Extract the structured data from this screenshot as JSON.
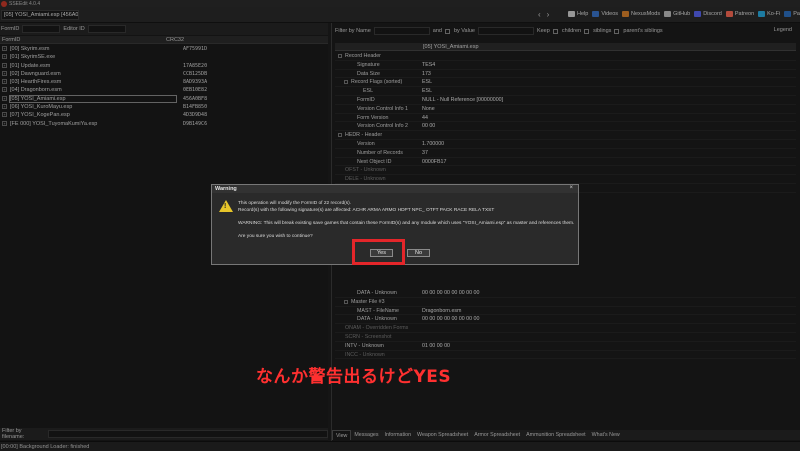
{
  "app": {
    "title": "SSEEdit 4.0.4"
  },
  "toolbar": {
    "path_field": "[05] YOSI_Amiami.esp [456A0BF8]",
    "back_arrow": "‹",
    "forward_arrow": "›",
    "links": [
      {
        "label": "Help",
        "icon": "home-icon",
        "color": "#d1d1d1"
      },
      {
        "label": "Videos",
        "icon": "video-icon",
        "color": "#3a73c9"
      },
      {
        "label": "NexusMods",
        "icon": "nexus-icon",
        "color": "#d9812b"
      },
      {
        "label": "GitHub",
        "icon": "github-icon",
        "color": "#bdbdbd"
      },
      {
        "label": "Discord",
        "icon": "discord-icon",
        "color": "#5865f2"
      },
      {
        "label": "Patreon",
        "icon": "patreon-icon",
        "color": "#f96854"
      },
      {
        "label": "Ko-Fi",
        "icon": "kofi-icon",
        "color": "#29abe0"
      },
      {
        "label": "PayPal",
        "icon": "paypal-icon",
        "color": "#2d6fc0"
      }
    ]
  },
  "left": {
    "filter_formid_label": "FormID",
    "filter_editorid_label": "Editor ID",
    "col_formid": "FormID",
    "col_crc": "CRC32",
    "plugins": [
      {
        "name": "[00] Skyrim.esm",
        "crc": "AF75991D"
      },
      {
        "name": "[01] SkyrimSE.exe",
        "crc": ""
      },
      {
        "name": "[01] Update.esm",
        "crc": "17A85E20"
      },
      {
        "name": "[02] Dawnguard.esm",
        "crc": "CCB125DB"
      },
      {
        "name": "[03] HearthFires.esm",
        "crc": "8AD9393A"
      },
      {
        "name": "[04] Dragonborn.esm",
        "crc": "0EB10E82"
      },
      {
        "name": "[05] YOSI_Amiami.esp",
        "crc": "456A0BF8",
        "selected": true
      },
      {
        "name": "[06] YOSI_KuroMayu.esp",
        "crc": "B14FB850"
      },
      {
        "name": "[07] YOSI_KogePan.esp",
        "crc": "4D3D9D48"
      },
      {
        "name": "[FE 000] YOSI_TuyomaKumiYa.esp",
        "crc": "D9B149C6"
      }
    ],
    "filter_by_filename_label": "Filter by filename:"
  },
  "right": {
    "filter_by_name": "Filter by Name",
    "and_label": "and",
    "by_value": "by Value",
    "keep_label": "Keep",
    "children": "children",
    "siblings": "siblings",
    "parents_siblings": "parent's siblings",
    "legend": "Legend",
    "record_header_title": "[05] YOSI_Amiami.esp",
    "rows": [
      {
        "label": "Record Header",
        "value": "",
        "indent": 1,
        "expander": true
      },
      {
        "label": "Signature",
        "value": "TES4",
        "indent": 3
      },
      {
        "label": "Data Size",
        "value": "173",
        "indent": 3
      },
      {
        "label": "Record Flags (sorted)",
        "value": "ESL",
        "indent": 2,
        "expander": true
      },
      {
        "label": "ESL",
        "value": "ESL",
        "indent": 4
      },
      {
        "label": "FormID",
        "value": "NULL - Null Reference [00000000]",
        "indent": 3
      },
      {
        "label": "Version Control Info 1",
        "value": "None",
        "indent": 3
      },
      {
        "label": "Form Version",
        "value": "44",
        "indent": 3
      },
      {
        "label": "Version Control Info 2",
        "value": "00 00",
        "indent": 3
      },
      {
        "label": "HEDR - Header",
        "value": "",
        "indent": 1,
        "expander": true
      },
      {
        "label": "Version",
        "value": "1.700000",
        "indent": 3
      },
      {
        "label": "Number of Records",
        "value": "37",
        "indent": 3
      },
      {
        "label": "Next Object ID",
        "value": "0000FB17",
        "indent": 3
      },
      {
        "label": "OFST - Unknown",
        "value": "",
        "indent": 1,
        "dim": true
      },
      {
        "label": "DELE - Unknown",
        "value": "",
        "indent": 1,
        "dim": true
      },
      {
        "label": "CNAM - Author",
        "value": "DEFAULT",
        "indent": 1
      }
    ],
    "rows_lower": [
      {
        "label": "DATA - Unknown",
        "value": "00 00 00 00 00 00 00 00",
        "indent": 3
      },
      {
        "label": "Master File #3",
        "value": "",
        "indent": 2,
        "expander": true
      },
      {
        "label": "MAST - FileName",
        "value": "Dragonborn.esm",
        "indent": 3
      },
      {
        "label": "DATA - Unknown",
        "value": "00 00 00 00 00 00 00 00",
        "indent": 3
      },
      {
        "label": "ONAM - Overridden Forms",
        "value": "",
        "indent": 1,
        "dim": true
      },
      {
        "label": "SCRN - Screenshot",
        "value": "",
        "indent": 1,
        "dim": true
      },
      {
        "label": "INTV - Unknown",
        "value": "01 00 00 00",
        "indent": 1
      },
      {
        "label": "INCC - Unknown",
        "value": "",
        "indent": 1,
        "dim": true
      }
    ],
    "tabs": [
      "View",
      "Messages",
      "Information",
      "Weapon Spreadsheet",
      "Armor Spreadsheet",
      "Ammunition Spreadsheet",
      "What's New"
    ]
  },
  "dialog": {
    "title": "Warning",
    "close": "×",
    "line1": "This operation will modify the FormID of 22 record(s).",
    "line2": "Record(s) with the following signature(s) are affected: ACHR ARMA ARMO HDPT NPC_ OTFT PACK RACE RELA TXST",
    "line3": "WARNING: This will break existing save games that contain these FormID(s) and any module which uses \"YOSI_Amiami.esp\" as master and references them.",
    "line4": "Are you sure you wish to continue?",
    "yes": "Yes",
    "no": "No"
  },
  "status": {
    "text": "[00:00] Background Loader: finished"
  },
  "annotation": {
    "caption": "なんか警告出るけどYES",
    "color": "#ff3030"
  }
}
